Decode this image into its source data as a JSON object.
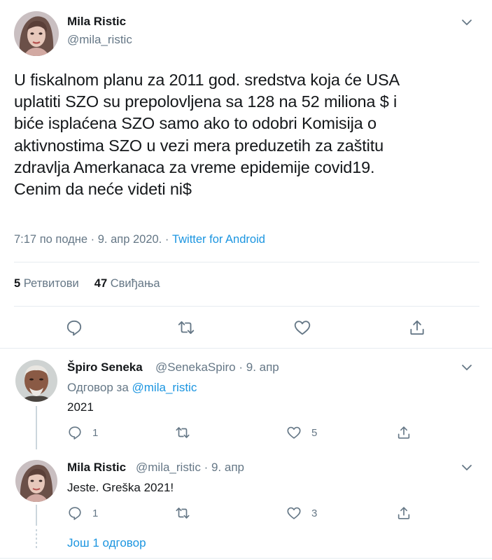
{
  "main": {
    "name": "Mila Ristic",
    "handle": "@mila_ristic",
    "text_lines": [
      "U fiskalnom planu za 2011 god. sredstva koja će USA",
      "uplatiti SZO su prepolovljena sa 128 na 52 miliona $ i",
      "biće isplaćena SZO samo ako to odobri Komisija o",
      "aktivnostima SZO u vezi mera preduzetih za zaštitu",
      "zdravlja Amerkanaca za vreme epidemije covid19.",
      "Cenim da neće videti ni$"
    ],
    "time": "7:17 по подне",
    "sep": "·",
    "date": "9. апр 2020.",
    "source": "Twitter for Android",
    "retweets_count": "5",
    "retweets_label": "Ретвитови",
    "likes_count": "47",
    "likes_label": "Свиђања"
  },
  "replies": [
    {
      "name": "Špiro Seneka",
      "handle": "@SenekaSpiro",
      "sep": "·",
      "date": "9. апр",
      "replying_label": "Одговор за",
      "replying_to": "@mila_ristic",
      "text": "2021",
      "reply_count": "1",
      "retweet_count": "",
      "like_count": "5"
    },
    {
      "name": "Mila Ristic",
      "handle": "@mila_ristic",
      "sep": "·",
      "date": "9. апр",
      "text": "Jeste. Greška 2021!",
      "reply_count": "1",
      "retweet_count": "",
      "like_count": "3"
    }
  ],
  "more_replies": "Још 1 одговор",
  "icons": {
    "reply": "reply-icon",
    "retweet": "retweet-icon",
    "like": "heart-icon",
    "share": "share-icon",
    "menu": "chevron-down-icon"
  },
  "colors": {
    "text": "#14171a",
    "secondary": "#657786",
    "link": "#1b95e0",
    "border": "#e6ecf0"
  }
}
